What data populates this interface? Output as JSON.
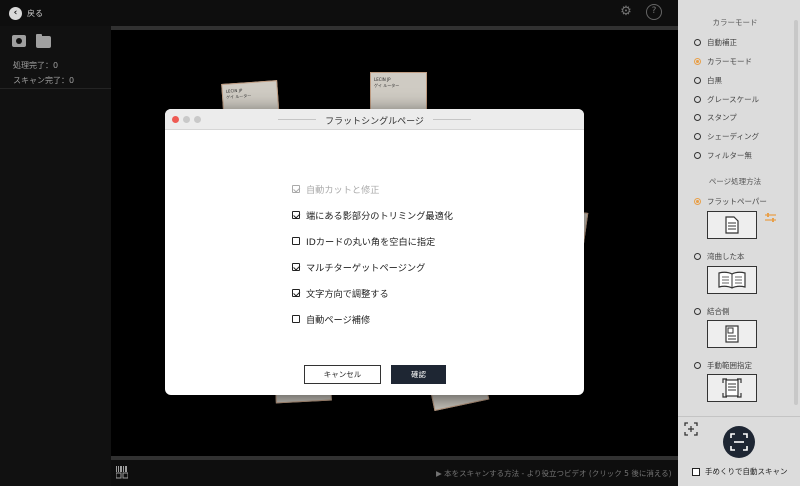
{
  "topbar": {
    "back_label": "戻る"
  },
  "left_panel": {
    "processed": "処理完了：0",
    "scanned": "スキャン完了：0"
  },
  "cards": [
    {
      "line1": "LECIN JP",
      "line2": "ゲイ ルーター"
    },
    {
      "line1": "LECIN JP",
      "line2": "ゲイ ルーター"
    }
  ],
  "bottom": {
    "hint": "本をスキャンする方法 - より役立つビデオ (クリック 5 後に消える)"
  },
  "right_panel": {
    "color_mode_title": "カラーモード",
    "color_modes": [
      {
        "label": "自動補正",
        "selected": false
      },
      {
        "label": "カラーモード",
        "selected": true
      },
      {
        "label": "白黒",
        "selected": false
      },
      {
        "label": "グレースケール",
        "selected": false
      },
      {
        "label": "スタンプ",
        "selected": false
      },
      {
        "label": "シェーディング",
        "selected": false
      },
      {
        "label": "フィルター無",
        "selected": false
      }
    ],
    "page_method_title": "ページ処理方法",
    "page_methods": [
      {
        "label": "フラットペーパー",
        "selected": true
      },
      {
        "label": "湾曲した本",
        "selected": false
      },
      {
        "label": "結合側",
        "selected": false
      },
      {
        "label": "手動範囲指定",
        "selected": false
      }
    ],
    "auto_scan_label": "手めくりで自動スキャン"
  },
  "dialog": {
    "title": "フラットシングルページ",
    "options": [
      {
        "label": "自動カットと修正",
        "checked": true,
        "disabled": true
      },
      {
        "label": "端にある影部分のトリミング最適化",
        "checked": true,
        "disabled": false
      },
      {
        "label": "IDカードの丸い角を空白に指定",
        "checked": false,
        "disabled": false
      },
      {
        "label": "マルチターゲットページング",
        "checked": true,
        "disabled": false
      },
      {
        "label": "文字方向で調整する",
        "checked": true,
        "disabled": false
      },
      {
        "label": "自動ページ補修",
        "checked": false,
        "disabled": false
      }
    ],
    "cancel_label": "キャンセル",
    "ok_label": "確認"
  },
  "colors": {
    "accent": "#e8a04a",
    "primary_button": "#1e2633",
    "close_dot": "#ee5a53"
  }
}
